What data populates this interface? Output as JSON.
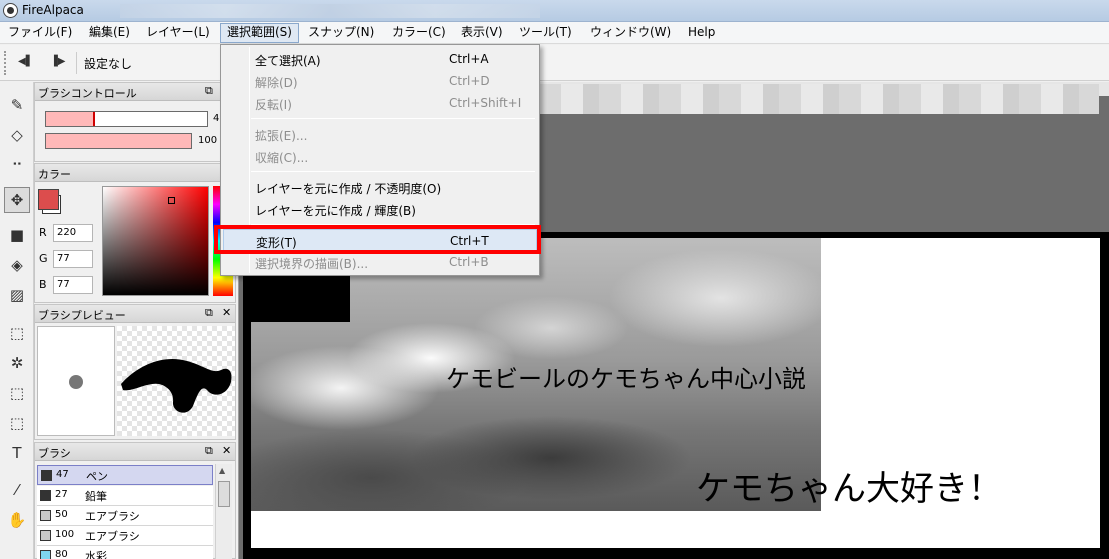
{
  "app": {
    "title": "FireAlpaca"
  },
  "menubar": {
    "items": [
      {
        "label": "ファイル(F)"
      },
      {
        "label": "編集(E)"
      },
      {
        "label": "レイヤー(L)"
      },
      {
        "label": "選択範囲(S)"
      },
      {
        "label": "スナップ(N)"
      },
      {
        "label": "カラー(C)"
      },
      {
        "label": "表示(V)"
      },
      {
        "label": "ツール(T)"
      },
      {
        "label": "ウィンドウ(W)"
      },
      {
        "label": "Help"
      }
    ]
  },
  "toolbar": {
    "setting_label": "設定なし"
  },
  "panels": {
    "brush_control": {
      "title": "ブラシコントロール",
      "size_value": "4",
      "opacity_value": "100",
      "size_fraction": 0.3,
      "opacity_fraction": 1.0
    },
    "color": {
      "title": "カラー",
      "r_label": "R",
      "r": "220",
      "g_label": "G",
      "g": "77",
      "b_label": "B",
      "b": "77",
      "fg_color": "#dc4d4d"
    },
    "brush_preview": {
      "title": "ブラシプレビュー"
    },
    "brush_list": {
      "title": "ブラシ",
      "items": [
        {
          "size": "47",
          "name": "ペン",
          "color": "#333333"
        },
        {
          "size": "27",
          "name": "鉛筆",
          "color": "#333333"
        },
        {
          "size": "50",
          "name": "エアブラシ",
          "color": "#c8c8c8"
        },
        {
          "size": "100",
          "name": "エアブラシ",
          "color": "#c8c8c8"
        },
        {
          "size": "80",
          "name": "水彩",
          "color": "#7fd6f0"
        }
      ]
    }
  },
  "dropdown": {
    "items": [
      {
        "label": "全て選択(A)",
        "shortcut": "Ctrl+A",
        "disabled": false
      },
      {
        "label": "解除(D)",
        "shortcut": "Ctrl+D",
        "disabled": true
      },
      {
        "label": "反転(I)",
        "shortcut": "Ctrl+Shift+I",
        "disabled": true
      },
      {
        "label": "拡張(E)...",
        "shortcut": "",
        "disabled": true
      },
      {
        "label": "収縮(C)...",
        "shortcut": "",
        "disabled": true
      },
      {
        "label": "レイヤーを元に作成 / 不透明度(O)",
        "shortcut": "",
        "disabled": false
      },
      {
        "label": "レイヤーを元に作成 / 輝度(B)",
        "shortcut": "",
        "disabled": false
      },
      {
        "label": "変形(T)",
        "shortcut": "Ctrl+T",
        "disabled": false
      },
      {
        "label": "選択境界の描画(B)...",
        "shortcut": "Ctrl+B",
        "disabled": true
      }
    ]
  },
  "canvas": {
    "text_1": "ケモビールのケモちゃん中心小説",
    "text_2": "ケモちゃん大好き！"
  },
  "icons": {
    "tools": [
      "pen-icon",
      "eraser-icon",
      "dot-icon",
      "move-icon",
      "fill-rect-icon",
      "bucket-icon",
      "gradient-icon",
      "select-rect-icon",
      "magic-wand-icon",
      "select-pen-icon",
      "select-eraser-icon",
      "text-icon",
      "eyedropper-icon",
      "hand-icon"
    ]
  },
  "colors": {
    "highlight": "#ff0000",
    "menu_hover": "#dde8f5"
  }
}
